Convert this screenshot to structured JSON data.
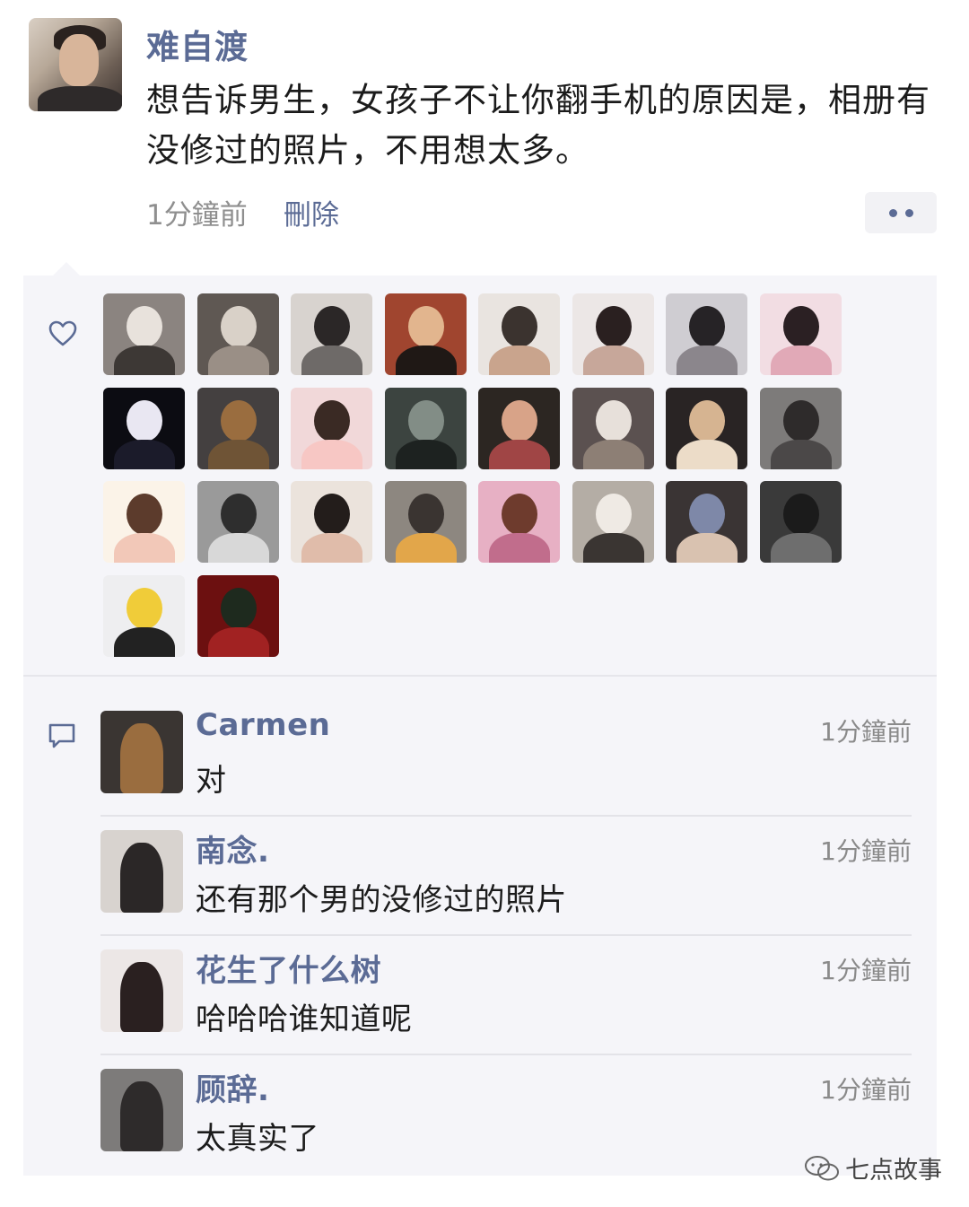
{
  "post": {
    "author": "难自渡",
    "text": "想告诉男生，女孩子不让你翻手机的原因是，相册有没修过的照片，不用想太多。",
    "time": "1分鐘前",
    "delete_label": "刪除",
    "more_icon": "more-dots-icon"
  },
  "likes": {
    "icon": "heart-icon",
    "avatars": [
      {
        "bg": "#8b8480",
        "fg": "#e8e2dc",
        "accent": "#3d3835"
      },
      {
        "bg": "#5f5853",
        "fg": "#d9d1c8",
        "accent": "#9a8f86"
      },
      {
        "bg": "#d8d3cf",
        "fg": "#2b2727",
        "accent": "#6e6a68"
      },
      {
        "bg": "#a0452f",
        "fg": "#e2b58e",
        "accent": "#1f1815"
      },
      {
        "bg": "#e9e4e0",
        "fg": "#3b332f",
        "accent": "#c9a48d"
      },
      {
        "bg": "#ece7e6",
        "fg": "#2a2020",
        "accent": "#c7a79a"
      },
      {
        "bg": "#cfcdd2",
        "fg": "#262326",
        "accent": "#8b868c"
      },
      {
        "bg": "#f2dde3",
        "fg": "#2b2023",
        "accent": "#e1a9b7"
      },
      {
        "bg": "#0c0c12",
        "fg": "#e9e7f2",
        "accent": "#1b1b2a"
      },
      {
        "bg": "#444040",
        "fg": "#9a6d3f",
        "accent": "#6f5436"
      },
      {
        "bg": "#f1d8d9",
        "fg": "#3a2a24",
        "accent": "#f7c7c4"
      },
      {
        "bg": "#3c4440",
        "fg": "#828d86",
        "accent": "#1d2220"
      },
      {
        "bg": "#2c2622",
        "fg": "#d8a388",
        "accent": "#a04545"
      },
      {
        "bg": "#5b5150",
        "fg": "#e7e0da",
        "accent": "#8d7f75"
      },
      {
        "bg": "#292424",
        "fg": "#d6b491",
        "accent": "#ecdcc8"
      },
      {
        "bg": "#7d7b7a",
        "fg": "#2e2b2b",
        "accent": "#4b4848"
      },
      {
        "bg": "#fbf3e8",
        "fg": "#5c3b2c",
        "accent": "#f2c8b8"
      },
      {
        "bg": "#9a9a9a",
        "fg": "#2e2e2e",
        "accent": "#d8d8d8"
      },
      {
        "bg": "#ebe3dc",
        "fg": "#231d1b",
        "accent": "#e0bcaa"
      },
      {
        "bg": "#8d8780",
        "fg": "#3a3431",
        "accent": "#e2a64a"
      },
      {
        "bg": "#e7b0c4",
        "fg": "#6e3b2d",
        "accent": "#c16d8c"
      },
      {
        "bg": "#b4ada5",
        "fg": "#efeae4",
        "accent": "#3a3532"
      },
      {
        "bg": "#3a3434",
        "fg": "#7e88a8",
        "accent": "#d9c2b0"
      },
      {
        "bg": "#3a3a3a",
        "fg": "#1b1b1b",
        "accent": "#6e6e6e"
      },
      {
        "bg": "#eeeef0",
        "fg": "#f0cc39",
        "accent": "#222222"
      },
      {
        "bg": "#6c1010",
        "fg": "#1e2a1e",
        "accent": "#a12222"
      }
    ]
  },
  "comments": {
    "icon": "comment-bubble-icon",
    "items": [
      {
        "name": "Carmen",
        "time": "1分鐘前",
        "text": "对",
        "avatar_bg": "#3a3532",
        "avatar_fg": "#9a6d3f"
      },
      {
        "name": "南念.",
        "time": "1分鐘前",
        "text": "还有那个男的没修过的照片",
        "avatar_bg": "#d8d3cf",
        "avatar_fg": "#2b2727"
      },
      {
        "name": "花生了什么树",
        "time": "1分鐘前",
        "text": "哈哈哈谁知道呢",
        "avatar_bg": "#ece7e6",
        "avatar_fg": "#2a2020"
      },
      {
        "name": "顾辞.",
        "time": "1分鐘前",
        "text": "太真实了",
        "avatar_bg": "#7d7b7a",
        "avatar_fg": "#2e2b2b"
      }
    ]
  },
  "watermark": {
    "text": "七点故事",
    "icon": "wechat-logo-icon"
  }
}
